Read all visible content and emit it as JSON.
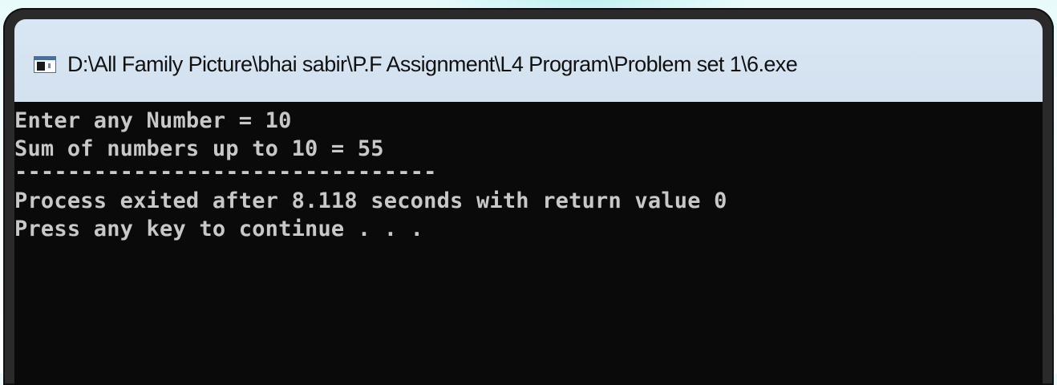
{
  "window": {
    "title": "D:\\All Family Picture\\bhai sabir\\P.F Assignment\\L4 Program\\Problem set 1\\6.exe",
    "icon": "console-app-icon"
  },
  "console": {
    "lines": [
      "Enter any Number = 10",
      "Sum of numbers up to 10 = 55",
      "--------------------------------",
      "Process exited after 8.118 seconds with return value 0",
      "Press any key to continue . . ."
    ]
  },
  "colors": {
    "console_background": "#0a0a0a",
    "console_text": "#c8c8c8",
    "titlebar": "#cfdeee",
    "frame": "#2a2a2a"
  }
}
